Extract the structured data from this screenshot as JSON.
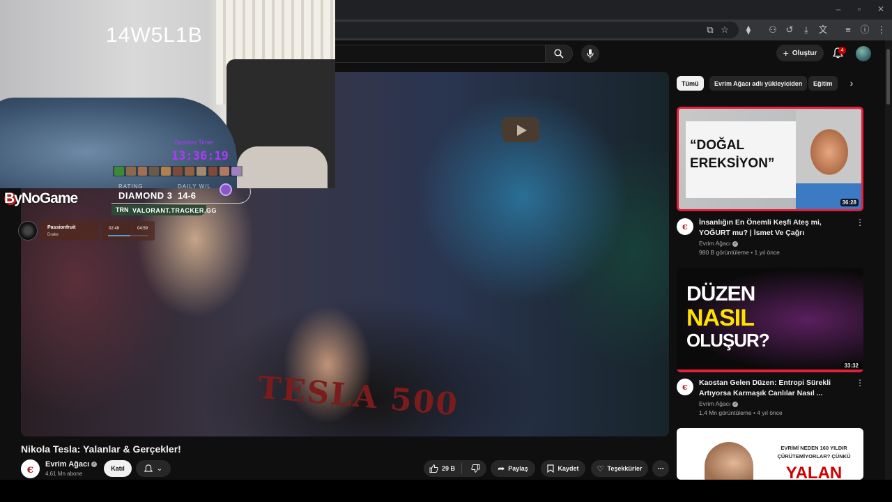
{
  "overlay": {
    "stream_code": "14W5L1B",
    "timer_label": "Session Timer",
    "timer": "13:36:19",
    "stats": {
      "rating_label": "RATING",
      "rating_value": "DIAMOND 3",
      "daily_label": "DAILY W/L",
      "daily_value": "14-6",
      "tracker_brand": "TRN",
      "tracker_url": "VALORANT.TRACKER.GG"
    },
    "sponsor": "ByNoGame",
    "music": {
      "title": "Passionfruit",
      "artist": "Drake",
      "current": "02:48",
      "total": "04:59",
      "progress": 0.56
    }
  },
  "header": {
    "create_label": "Oluştur",
    "notification_count": "4"
  },
  "video": {
    "title": "Nikola Tesla: Yalanlar & Gerçekler!",
    "shirt_text": "TESLA 500",
    "channel": {
      "name": "Evrim Ağacı",
      "subscribers": "4,61 Mn abone",
      "initial": "ϵ"
    },
    "join_label": "Katıl",
    "likes": "29 B",
    "share_label": "Paylaş",
    "save_label": "Kaydet",
    "thanks_label": "Teşekkürler"
  },
  "sidebar": {
    "chips": [
      "Tümü",
      "Evrim Ağacı adlı yükleyiciden",
      "Eğitim"
    ],
    "related": [
      {
        "title": "İnsanlığın En Önemli Keşfi Ateş mi, YOĞURT mu? | İsmet Ve Çağrı",
        "channel": "Evrim Ağacı",
        "meta": "980 B görüntüleme • 1 yıl önce",
        "duration": "36:28",
        "thumb_text": "“DOĞAL EREKSİYON”"
      },
      {
        "title": "Kaostan Gelen Düzen: Entropi Sürekli Artıyorsa Karmaşık Canlılar Nasıl ...",
        "channel": "Evrim Ağacı",
        "meta": "1,4 Mn görüntüleme • 4 yıl önce",
        "duration": "33:32",
        "thumb_line1": "DÜZEN",
        "thumb_line2": "NASIL",
        "thumb_line3": "OLUŞUR?"
      },
      {
        "thumb_line1": "EVRİMİ NEDEN 160 YILDIR",
        "thumb_line2": "ÇÜRÜTEMİYORLAR? ÇÜNKÜ",
        "thumb_line3": "YALAN"
      }
    ]
  },
  "colors": {
    "accent_red": "#cc0000",
    "timer_purple": "#b038ff",
    "thumb_border": "#e91e3a",
    "nasil_yellow": "#ffe100"
  }
}
